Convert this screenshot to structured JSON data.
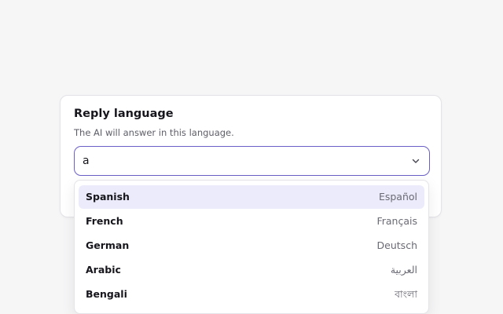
{
  "card": {
    "title": "Reply language",
    "subtitle": "The AI will answer in this language."
  },
  "combobox": {
    "value": "a",
    "icon": "chevron-down-icon"
  },
  "options": [
    {
      "name": "Spanish",
      "native": "Español",
      "highlighted": true
    },
    {
      "name": "French",
      "native": "Français",
      "highlighted": false
    },
    {
      "name": "German",
      "native": "Deutsch",
      "highlighted": false
    },
    {
      "name": "Arabic",
      "native": "العربية",
      "highlighted": false
    },
    {
      "name": "Bengali",
      "native": "বাংলা",
      "highlighted": false
    }
  ],
  "colors": {
    "accent": "#6a5fc6",
    "highlight": "#ecebfb"
  }
}
